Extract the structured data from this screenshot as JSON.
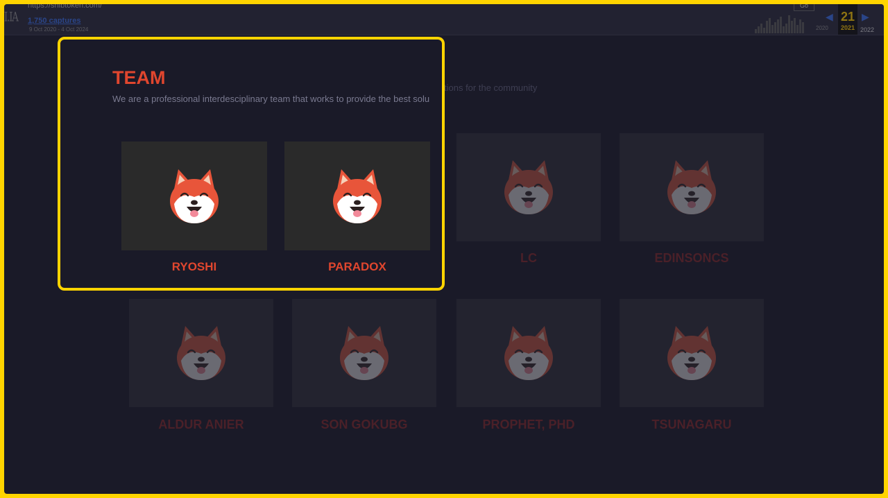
{
  "wayback": {
    "url": "https://shibtoken.com/",
    "captures_label": "1,750 captures",
    "date_range": "9 Oct 2020 - 4 Oct 2024",
    "go_label": "Go",
    "current_day": "21",
    "current_year": "2021",
    "next_year": "2022",
    "prev_year": "2020"
  },
  "section": {
    "title": "TEAM",
    "subtitle": "We are a professional interdesciplinary team that works to provide the best solu",
    "subtitle_dim_rest": "tions for the community"
  },
  "highlighted_members": [
    {
      "name": "RYOSHI"
    },
    {
      "name": "PARADOX"
    }
  ],
  "dimmed_members_row1": [
    {
      "name": "LC"
    },
    {
      "name": "EDINSONCS"
    }
  ],
  "dimmed_members_row2": [
    {
      "name": "ALDUR ANIER"
    },
    {
      "name": "SON GOKUBG"
    },
    {
      "name": "PROPHET, PHD"
    },
    {
      "name": "TSUNAGARU"
    }
  ],
  "colors": {
    "highlight": "#ffd400",
    "accent": "#e0462e",
    "background": "#1a1a28"
  },
  "icons": [
    "shiba-fox-avatar-icon"
  ]
}
